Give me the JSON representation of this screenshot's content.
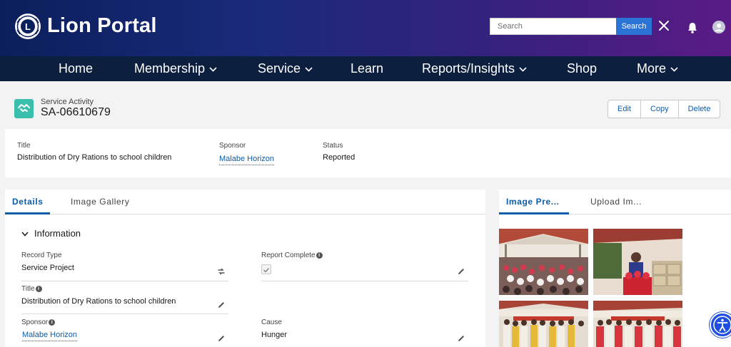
{
  "header": {
    "brand": "Lion Portal",
    "search_placeholder": "Search",
    "search_button": "Search",
    "close_icon": "close-icon",
    "bell_icon": "bell-icon",
    "user_icon": "user-avatar-icon",
    "colors": {
      "gradient_start": "#0b1f5c",
      "gradient_end": "#5a1b86",
      "search_button": "#2c73d6"
    }
  },
  "nav": {
    "items": [
      {
        "label": "Home",
        "has_dropdown": false
      },
      {
        "label": "Membership",
        "has_dropdown": true
      },
      {
        "label": "Service",
        "has_dropdown": true
      },
      {
        "label": "Learn",
        "has_dropdown": false
      },
      {
        "label": "Reports/Insights",
        "has_dropdown": true
      },
      {
        "label": "Shop",
        "has_dropdown": false
      },
      {
        "label": "More",
        "has_dropdown": true
      }
    ]
  },
  "record": {
    "object_label": "Service Activity",
    "name": "SA-06610679",
    "icon": "handshake-icon",
    "actions": [
      "Edit",
      "Copy",
      "Delete"
    ]
  },
  "highlights": {
    "title_label": "Title",
    "title_value": "Distribution of Dry Rations to school children",
    "sponsor_label": "Sponsor",
    "sponsor_value": "Malabe Horizon",
    "status_label": "Status",
    "status_value": "Reported"
  },
  "details": {
    "tabs": [
      "Details",
      "Image Gallery"
    ],
    "active_tab": "Details",
    "section_title": "Information",
    "fields": {
      "record_type_label": "Record Type",
      "record_type_value": "Service Project",
      "report_complete_label": "Report Complete",
      "report_complete_checked": true,
      "title_label": "Title",
      "title_value": "Distribution of Dry Rations to school children",
      "sponsor_label": "Sponsor",
      "sponsor_value": "Malabe Horizon",
      "cause_label": "Cause",
      "cause_value": "Hunger"
    }
  },
  "images": {
    "tabs": [
      "Image Pre...",
      "Upload Im..."
    ],
    "active_tab": "Image Pre..."
  },
  "accessibility_icon": "accessibility-icon"
}
